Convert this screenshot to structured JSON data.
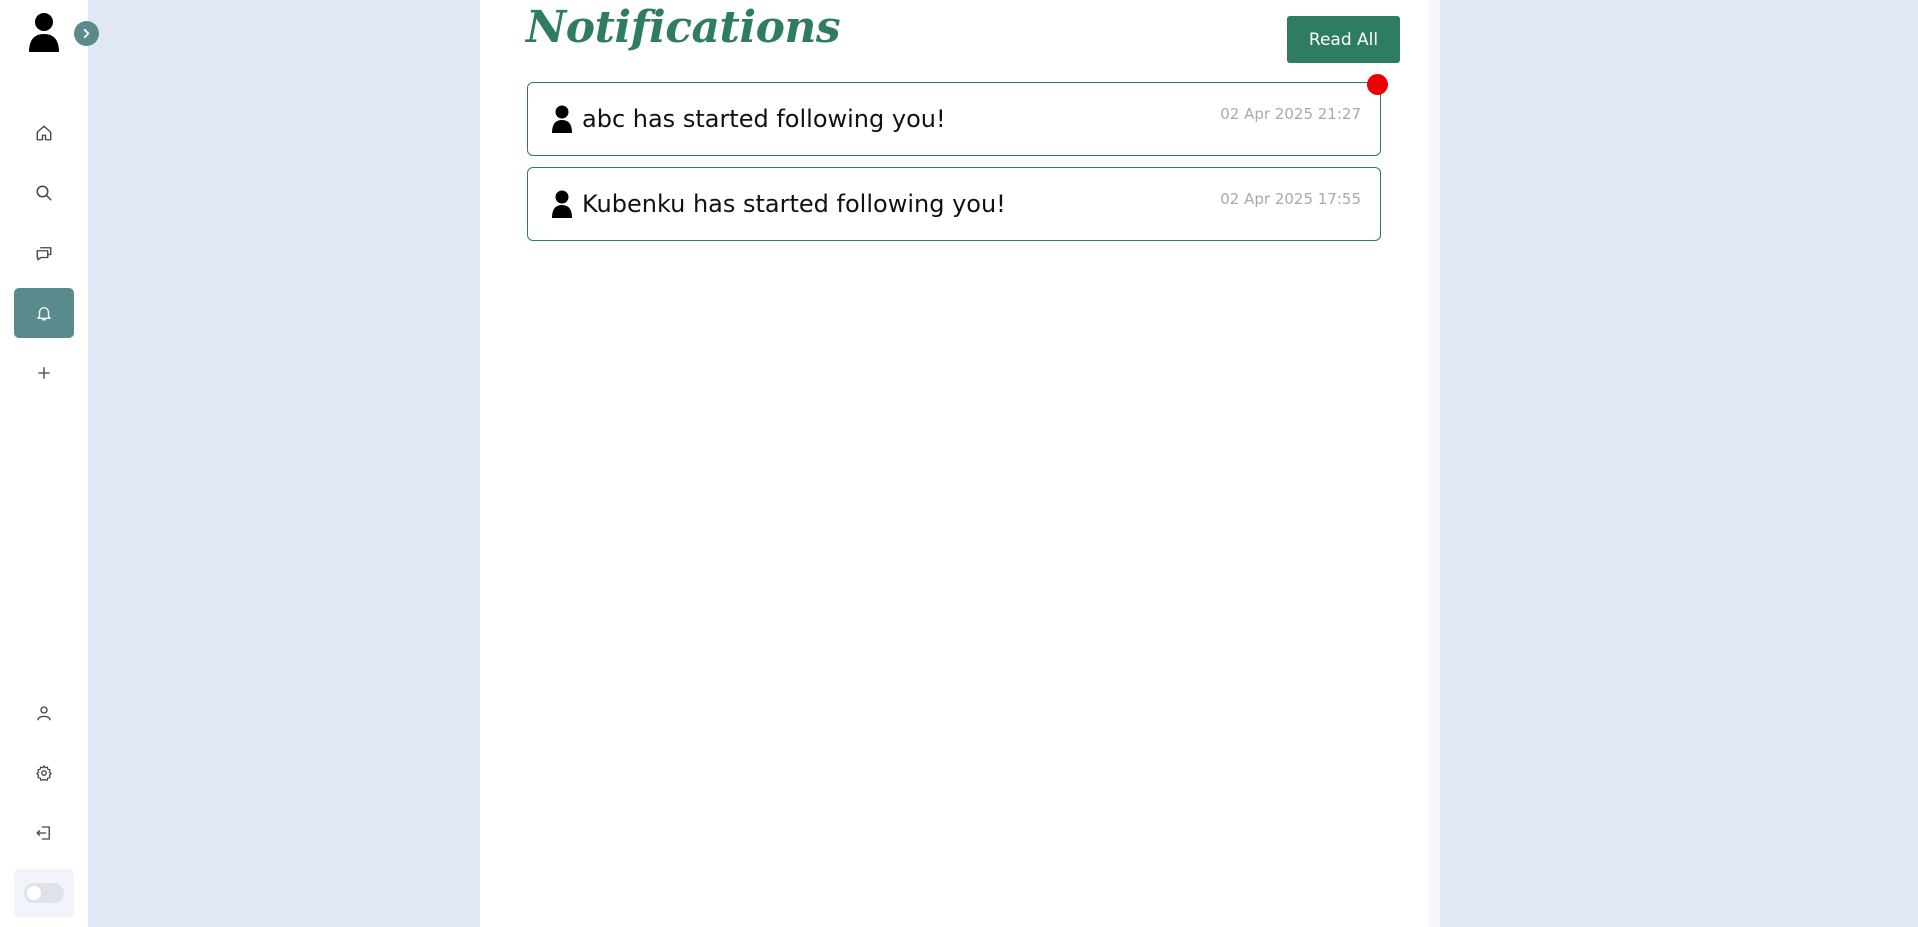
{
  "sidebar": {
    "avatar_icon": "user-icon",
    "expand_icon": "chevron-right-icon",
    "nav": [
      {
        "name": "home",
        "icon": "home-icon",
        "active": false
      },
      {
        "name": "search",
        "icon": "search-icon",
        "active": false
      },
      {
        "name": "messages",
        "icon": "chat-icon",
        "active": false
      },
      {
        "name": "notifications",
        "icon": "bell-icon",
        "active": true
      },
      {
        "name": "create",
        "icon": "plus-icon",
        "active": false
      }
    ],
    "bottom_nav": [
      {
        "name": "profile",
        "icon": "user-icon"
      },
      {
        "name": "settings",
        "icon": "gear-icon"
      },
      {
        "name": "logout",
        "icon": "logout-icon"
      }
    ],
    "theme_toggle": {
      "on": false
    }
  },
  "page": {
    "title": "Notifications",
    "read_all_label": "Read All"
  },
  "notifications": [
    {
      "text": "abc has started following you!",
      "time": "02 Apr 2025 21:27",
      "unread": true,
      "icon": "user-icon"
    },
    {
      "text": "Kubenku has started following you!",
      "time": "02 Apr 2025 17:55",
      "unread": false,
      "icon": "user-icon"
    }
  ],
  "colors": {
    "accent": "#2e7d62",
    "sidebar_active": "#5b8a8d",
    "background": "#e1e7f5",
    "unread_dot": "#ee0000"
  }
}
